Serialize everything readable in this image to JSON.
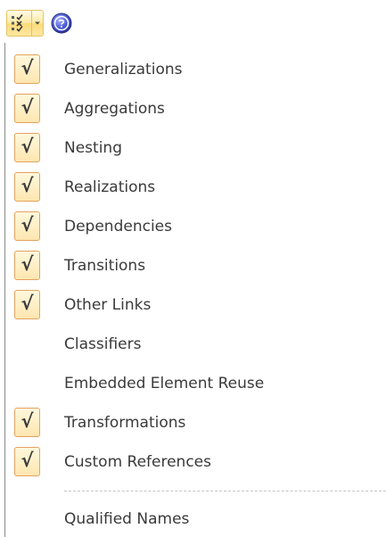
{
  "toolbar": {
    "button_icon": "checklist-icon",
    "dropdown_icon": "chevron-down-icon",
    "help_icon": "help-icon",
    "accent_colors": {
      "button_border": "#e5c365",
      "checkbox_border": "#e3a35f",
      "help_blue": "#4b5bd8"
    }
  },
  "menu": {
    "check_glyph": "√",
    "items": [
      {
        "label": "Generalizations",
        "checked": true
      },
      {
        "label": "Aggregations",
        "checked": true
      },
      {
        "label": "Nesting",
        "checked": true
      },
      {
        "label": "Realizations",
        "checked": true
      },
      {
        "label": "Dependencies",
        "checked": true
      },
      {
        "label": "Transitions",
        "checked": true
      },
      {
        "label": "Other Links",
        "checked": true
      },
      {
        "label": "Classifiers",
        "checked": false
      },
      {
        "label": "Embedded Element Reuse",
        "checked": false
      },
      {
        "label": "Transformations",
        "checked": true
      },
      {
        "label": "Custom References",
        "checked": true
      }
    ],
    "after_separator": [
      {
        "label": "Qualified Names",
        "checked": false
      }
    ]
  }
}
